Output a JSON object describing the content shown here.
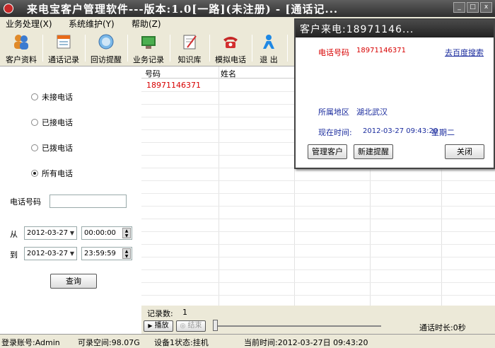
{
  "window": {
    "title": "来电宝客户管理软件---版本:1.0[一路](未注册) - [通话记..."
  },
  "menu": [
    "业务处理(X)",
    "系统维护(Y)",
    "帮助(Z)"
  ],
  "toolbar": {
    "buttons": [
      {
        "label": "客户资料",
        "icon": "people-icon"
      },
      {
        "label": "通话记录",
        "icon": "call-log-icon"
      },
      {
        "label": "回访提醒",
        "icon": "reminder-icon"
      },
      {
        "label": "业务记录",
        "icon": "business-record-icon"
      },
      {
        "label": "知识库",
        "icon": "knowledge-icon"
      },
      {
        "label": "模拟电话",
        "icon": "telephone-icon"
      },
      {
        "label": "退 出",
        "icon": "exit-icon"
      }
    ]
  },
  "filters": {
    "options": [
      "未接电话",
      "已接电话",
      "已拨电话",
      "所有电话"
    ],
    "selected": "所有电话",
    "phone_label": "电话号码",
    "phone_value": "",
    "from_label": "从",
    "to_label": "到",
    "from_date": "2012-03-27",
    "from_time": "00:00:00",
    "to_date": "2012-03-27",
    "to_time": "23:59:59",
    "query_button": "查询"
  },
  "table": {
    "headers": [
      "号码",
      "姓名"
    ],
    "rows": [
      {
        "number": "18971146371",
        "name": ""
      }
    ]
  },
  "records": {
    "label": "记录数:",
    "count": "1"
  },
  "player": {
    "play": "播放",
    "stop": "结束",
    "duration": "通话时长:0秒"
  },
  "status": {
    "account": "登录账号:Admin",
    "space": "可录空间:98.07G",
    "device": "设备1状态:挂机",
    "time": "当前时间:2012-03-27日 09:43:20"
  },
  "popup": {
    "title": "客户来电:18971146...",
    "phone_label": "电话号码",
    "phone": "18971146371",
    "search_link": "去百度搜索",
    "region_label": "所属地区",
    "region": "湖北武汉",
    "time_label": "现在时间:",
    "time": "2012-03-27 09:43:20",
    "weekday": "星期二",
    "btn_manage": "管理客户",
    "btn_new": "新建提醒",
    "btn_close": "关闭"
  },
  "colors": {
    "accent_red": "#d80000",
    "link_blue": "#1b2c9e"
  }
}
